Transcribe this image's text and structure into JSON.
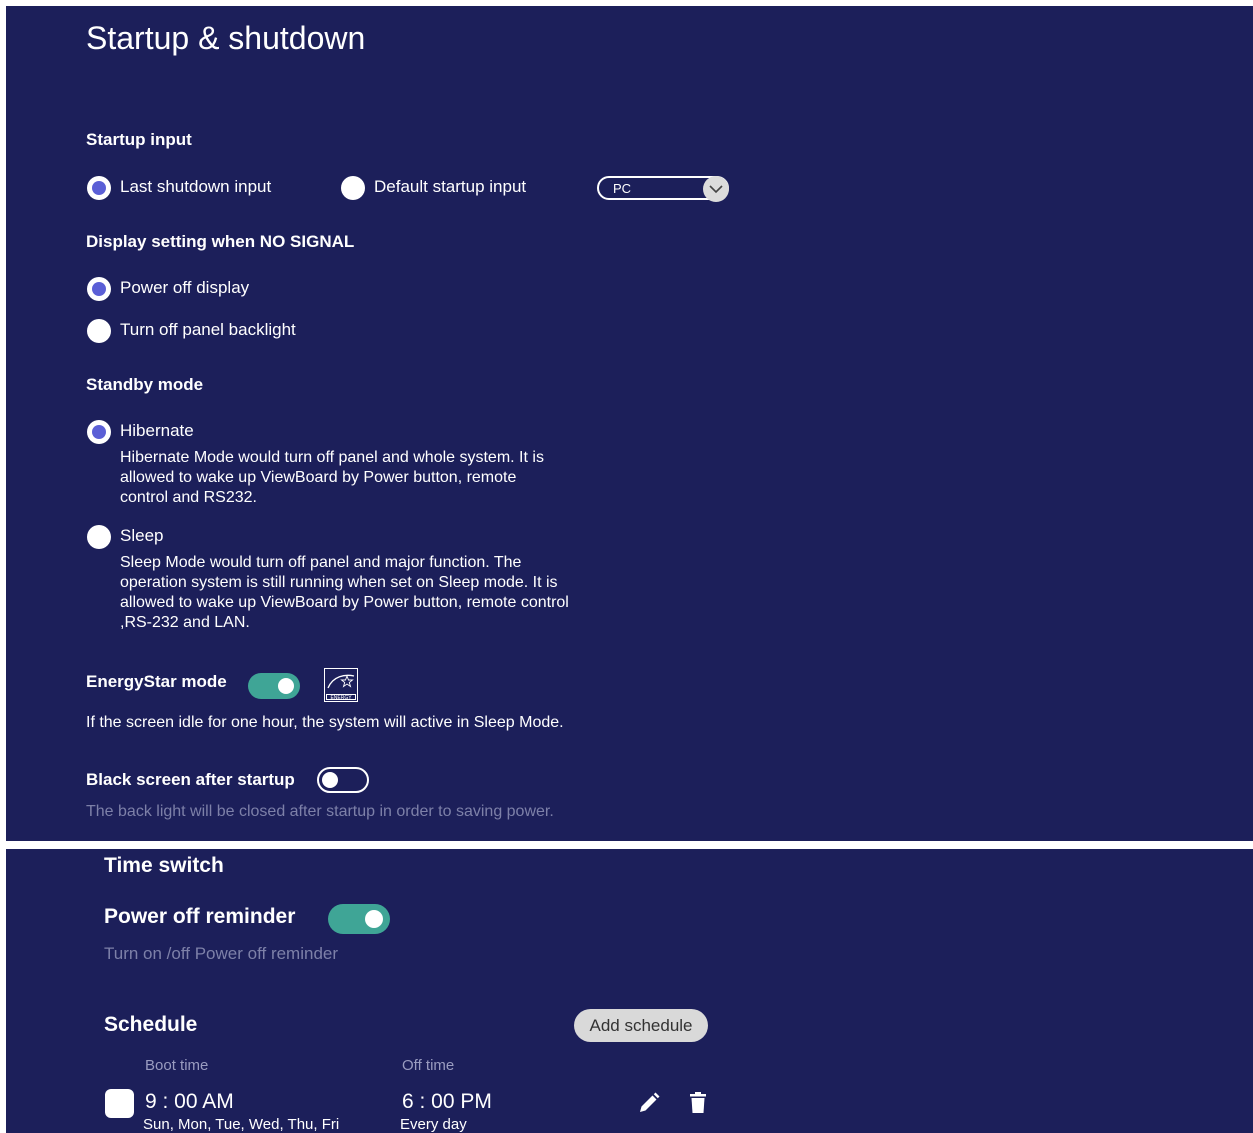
{
  "startup": {
    "title": "Startup & shutdown",
    "startup_input": {
      "heading": "Startup input",
      "option_last": "Last shutdown input",
      "option_default": "Default startup input",
      "selected": "last",
      "dropdown_value": "PC"
    },
    "no_signal": {
      "heading": "Display setting when NO SIGNAL",
      "option_power_off": "Power off display",
      "option_backlight": "Turn off panel backlight",
      "selected": "power_off"
    },
    "standby": {
      "heading": "Standby mode",
      "hibernate_label": "Hibernate",
      "hibernate_desc": "Hibernate Mode would turn off panel and whole system. It is allowed to wake up ViewBoard by Power button, remote control and RS232.",
      "sleep_label": "Sleep",
      "sleep_desc": "Sleep Mode would turn off panel and major function. The operation system is still running when set on Sleep mode. It is allowed to wake up ViewBoard by Power button, remote control ,RS-232 and LAN.",
      "selected": "hibernate"
    },
    "energystar": {
      "label": "EnergyStar mode",
      "enabled": true,
      "desc": "If the screen idle for one hour, the system will active in Sleep Mode.",
      "logo_text": "ENERGY STAR"
    },
    "black_screen": {
      "label": "Black screen after startup",
      "enabled": false,
      "desc": "The back light will be closed after startup in order to saving power."
    }
  },
  "time_switch": {
    "heading": "Time switch",
    "reminder_label": "Power off reminder",
    "reminder_enabled": true,
    "reminder_desc": "Turn on /off Power off reminder",
    "schedule_label": "Schedule",
    "add_button": "Add schedule",
    "boot_header": "Boot time",
    "off_header": "Off time",
    "entries": [
      {
        "boot_time": "9 : 00 AM",
        "boot_days": "Sun, Mon, Tue, Wed, Thu, Fri",
        "off_time": "6 : 00 PM",
        "off_days": "Every day"
      }
    ]
  },
  "colors": {
    "background": "#1c1f5a",
    "accent_radio": "#5b5fd6",
    "toggle_on": "#3fa596"
  },
  "icons": [
    "chevron-down-icon",
    "energy-star-logo",
    "edit-pencil-icon",
    "trash-icon"
  ]
}
